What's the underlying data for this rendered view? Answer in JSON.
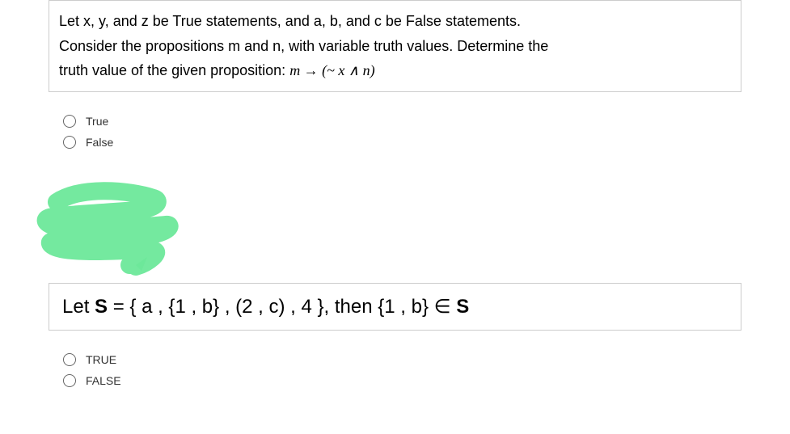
{
  "question1": {
    "prompt_line1": "Let x, y, and z be True statements, and a, b, and c be False statements.",
    "prompt_line2": "Consider the propositions m and n, with variable truth values. Determine the",
    "prompt_line3_prefix": "truth value of the given proposition: ",
    "formula": "m  →  (~ x ∧ n)",
    "options": [
      {
        "label": "True"
      },
      {
        "label": "False"
      }
    ]
  },
  "question2": {
    "prompt_prefix": "Let ",
    "set_var": "S",
    "equals": " = { a , {1 , b} , (2 , c) , 4 }, then  {1 , b}  ",
    "element_symbol": "∈",
    "set_var2": " S",
    "options": [
      {
        "label": "TRUE"
      },
      {
        "label": "FALSE"
      }
    ]
  }
}
